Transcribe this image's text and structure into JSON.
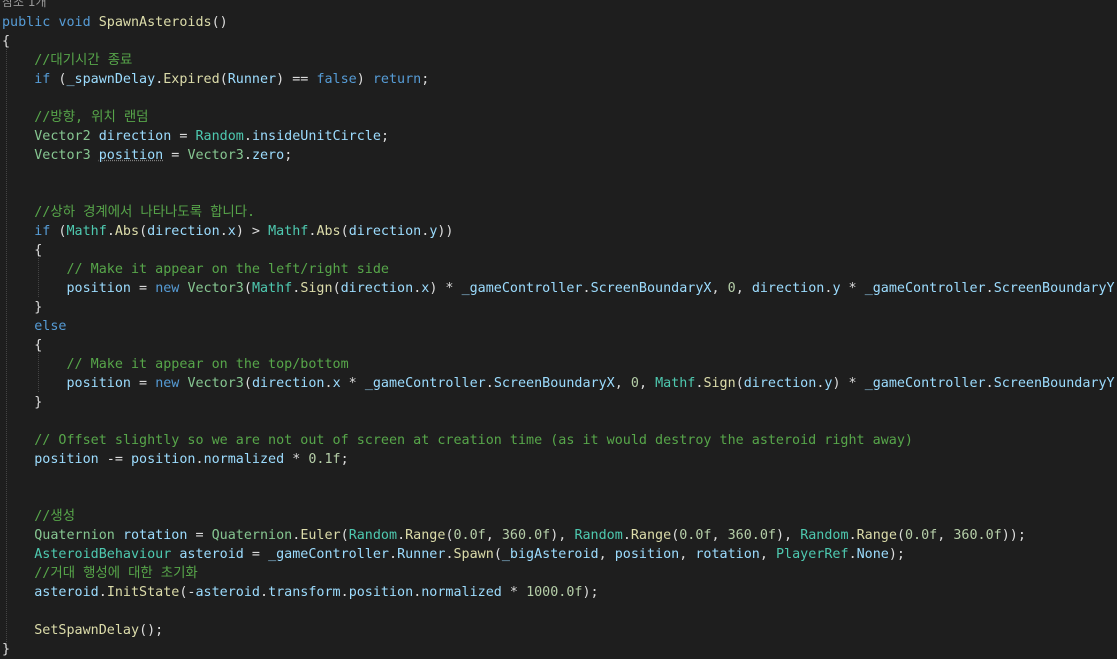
{
  "editor": {
    "codelens": "참조 1개",
    "lines": [
      [
        {
          "t": "public",
          "c": "kw"
        },
        {
          "t": " "
        },
        {
          "t": "void",
          "c": "kw"
        },
        {
          "t": " "
        },
        {
          "t": "SpawnAsteroids",
          "c": "fn"
        },
        {
          "t": "()"
        }
      ],
      [
        {
          "t": "{"
        }
      ],
      [
        {
          "t": "    //대기시간 종료",
          "c": "cm"
        }
      ],
      [
        {
          "t": "    "
        },
        {
          "t": "if",
          "c": "kw"
        },
        {
          "t": " ("
        },
        {
          "t": "_spawnDelay",
          "c": "var"
        },
        {
          "t": "."
        },
        {
          "t": "Expired",
          "c": "fn"
        },
        {
          "t": "("
        },
        {
          "t": "Runner",
          "c": "var"
        },
        {
          "t": ") == "
        },
        {
          "t": "false",
          "c": "kw"
        },
        {
          "t": ") "
        },
        {
          "t": "return",
          "c": "kw"
        },
        {
          "t": ";"
        }
      ],
      [],
      [
        {
          "t": "    //방향, 위치 랜덤",
          "c": "cm"
        }
      ],
      [
        {
          "t": "    "
        },
        {
          "t": "Vector2",
          "c": "vt"
        },
        {
          "t": " "
        },
        {
          "t": "direction",
          "c": "var"
        },
        {
          "t": " = "
        },
        {
          "t": "Random",
          "c": "ty"
        },
        {
          "t": "."
        },
        {
          "t": "insideUnitCircle",
          "c": "var"
        },
        {
          "t": ";"
        }
      ],
      [
        {
          "t": "    "
        },
        {
          "t": "Vector3",
          "c": "vt"
        },
        {
          "t": " "
        },
        {
          "t": "position",
          "c": "var",
          "u": 1
        },
        {
          "t": " = "
        },
        {
          "t": "Vector3",
          "c": "vt"
        },
        {
          "t": "."
        },
        {
          "t": "zero",
          "c": "var"
        },
        {
          "t": ";"
        }
      ],
      [],
      [],
      [
        {
          "t": "    //상하 경계에서 나타나도록 합니다.",
          "c": "cm"
        }
      ],
      [
        {
          "t": "    "
        },
        {
          "t": "if",
          "c": "kw"
        },
        {
          "t": " ("
        },
        {
          "t": "Mathf",
          "c": "ty"
        },
        {
          "t": "."
        },
        {
          "t": "Abs",
          "c": "fn"
        },
        {
          "t": "("
        },
        {
          "t": "direction",
          "c": "var"
        },
        {
          "t": "."
        },
        {
          "t": "x",
          "c": "var"
        },
        {
          "t": ") > "
        },
        {
          "t": "Mathf",
          "c": "ty"
        },
        {
          "t": "."
        },
        {
          "t": "Abs",
          "c": "fn"
        },
        {
          "t": "("
        },
        {
          "t": "direction",
          "c": "var"
        },
        {
          "t": "."
        },
        {
          "t": "y",
          "c": "var"
        },
        {
          "t": "))"
        }
      ],
      [
        {
          "t": "    {"
        }
      ],
      [
        {
          "t": "        // Make it appear on the left/right side",
          "c": "cm"
        }
      ],
      [
        {
          "t": "        "
        },
        {
          "t": "position",
          "c": "var"
        },
        {
          "t": " = "
        },
        {
          "t": "new",
          "c": "kw"
        },
        {
          "t": " "
        },
        {
          "t": "Vector3",
          "c": "vt"
        },
        {
          "t": "("
        },
        {
          "t": "Mathf",
          "c": "ty"
        },
        {
          "t": "."
        },
        {
          "t": "Sign",
          "c": "fn"
        },
        {
          "t": "("
        },
        {
          "t": "direction",
          "c": "var"
        },
        {
          "t": "."
        },
        {
          "t": "x",
          "c": "var"
        },
        {
          "t": ") * "
        },
        {
          "t": "_gameController",
          "c": "var"
        },
        {
          "t": "."
        },
        {
          "t": "ScreenBoundaryX",
          "c": "var"
        },
        {
          "t": ", "
        },
        {
          "t": "0",
          "c": "num"
        },
        {
          "t": ", "
        },
        {
          "t": "direction",
          "c": "var"
        },
        {
          "t": "."
        },
        {
          "t": "y",
          "c": "var"
        },
        {
          "t": " * "
        },
        {
          "t": "_gameController",
          "c": "var"
        },
        {
          "t": "."
        },
        {
          "t": "ScreenBoundaryY",
          "c": "var"
        },
        {
          "t": ");"
        }
      ],
      [
        {
          "t": "    }"
        }
      ],
      [
        {
          "t": "    "
        },
        {
          "t": "else",
          "c": "kw"
        }
      ],
      [
        {
          "t": "    {"
        }
      ],
      [
        {
          "t": "        // Make it appear on the top/bottom",
          "c": "cm"
        }
      ],
      [
        {
          "t": "        "
        },
        {
          "t": "position",
          "c": "var"
        },
        {
          "t": " = "
        },
        {
          "t": "new",
          "c": "kw"
        },
        {
          "t": " "
        },
        {
          "t": "Vector3",
          "c": "vt"
        },
        {
          "t": "("
        },
        {
          "t": "direction",
          "c": "var"
        },
        {
          "t": "."
        },
        {
          "t": "x",
          "c": "var"
        },
        {
          "t": " * "
        },
        {
          "t": "_gameController",
          "c": "var"
        },
        {
          "t": "."
        },
        {
          "t": "ScreenBoundaryX",
          "c": "var"
        },
        {
          "t": ", "
        },
        {
          "t": "0",
          "c": "num"
        },
        {
          "t": ", "
        },
        {
          "t": "Mathf",
          "c": "ty"
        },
        {
          "t": "."
        },
        {
          "t": "Sign",
          "c": "fn"
        },
        {
          "t": "("
        },
        {
          "t": "direction",
          "c": "var"
        },
        {
          "t": "."
        },
        {
          "t": "y",
          "c": "var"
        },
        {
          "t": ") * "
        },
        {
          "t": "_gameController",
          "c": "var"
        },
        {
          "t": "."
        },
        {
          "t": "ScreenBoundaryY",
          "c": "var"
        },
        {
          "t": ");"
        }
      ],
      [
        {
          "t": "    }"
        }
      ],
      [],
      [
        {
          "t": "    // Offset slightly so we are not out of screen at creation time (as it would destroy the asteroid right away)",
          "c": "cm"
        }
      ],
      [
        {
          "t": "    "
        },
        {
          "t": "position",
          "c": "var"
        },
        {
          "t": " -= "
        },
        {
          "t": "position",
          "c": "var"
        },
        {
          "t": "."
        },
        {
          "t": "normalized",
          "c": "var"
        },
        {
          "t": " * "
        },
        {
          "t": "0.1f",
          "c": "num"
        },
        {
          "t": ";"
        }
      ],
      [],
      [],
      [
        {
          "t": "    //생성",
          "c": "cm"
        }
      ],
      [
        {
          "t": "    "
        },
        {
          "t": "Quaternion",
          "c": "vt"
        },
        {
          "t": " "
        },
        {
          "t": "rotation",
          "c": "var"
        },
        {
          "t": " = "
        },
        {
          "t": "Quaternion",
          "c": "vt"
        },
        {
          "t": "."
        },
        {
          "t": "Euler",
          "c": "fn"
        },
        {
          "t": "("
        },
        {
          "t": "Random",
          "c": "ty"
        },
        {
          "t": "."
        },
        {
          "t": "Range",
          "c": "fn"
        },
        {
          "t": "("
        },
        {
          "t": "0.0f",
          "c": "num"
        },
        {
          "t": ", "
        },
        {
          "t": "360.0f",
          "c": "num"
        },
        {
          "t": "), "
        },
        {
          "t": "Random",
          "c": "ty"
        },
        {
          "t": "."
        },
        {
          "t": "Range",
          "c": "fn"
        },
        {
          "t": "("
        },
        {
          "t": "0.0f",
          "c": "num"
        },
        {
          "t": ", "
        },
        {
          "t": "360.0f",
          "c": "num"
        },
        {
          "t": "), "
        },
        {
          "t": "Random",
          "c": "ty"
        },
        {
          "t": "."
        },
        {
          "t": "Range",
          "c": "fn"
        },
        {
          "t": "("
        },
        {
          "t": "0.0f",
          "c": "num"
        },
        {
          "t": ", "
        },
        {
          "t": "360.0f",
          "c": "num"
        },
        {
          "t": "));"
        }
      ],
      [
        {
          "t": "    "
        },
        {
          "t": "AsteroidBehaviour",
          "c": "ty"
        },
        {
          "t": " "
        },
        {
          "t": "asteroid",
          "c": "var"
        },
        {
          "t": " = "
        },
        {
          "t": "_gameController",
          "c": "var"
        },
        {
          "t": "."
        },
        {
          "t": "Runner",
          "c": "var"
        },
        {
          "t": "."
        },
        {
          "t": "Spawn",
          "c": "fn"
        },
        {
          "t": "("
        },
        {
          "t": "_bigAsteroid",
          "c": "var"
        },
        {
          "t": ", "
        },
        {
          "t": "position",
          "c": "var"
        },
        {
          "t": ", "
        },
        {
          "t": "rotation",
          "c": "var"
        },
        {
          "t": ", "
        },
        {
          "t": "PlayerRef",
          "c": "ty"
        },
        {
          "t": "."
        },
        {
          "t": "None",
          "c": "var"
        },
        {
          "t": ");"
        }
      ],
      [
        {
          "t": "    //거대 행성에 대한 초기화",
          "c": "cm"
        }
      ],
      [
        {
          "t": "    "
        },
        {
          "t": "asteroid",
          "c": "var"
        },
        {
          "t": "."
        },
        {
          "t": "InitState",
          "c": "fn"
        },
        {
          "t": "(-"
        },
        {
          "t": "asteroid",
          "c": "var"
        },
        {
          "t": "."
        },
        {
          "t": "transform",
          "c": "var"
        },
        {
          "t": "."
        },
        {
          "t": "position",
          "c": "var"
        },
        {
          "t": "."
        },
        {
          "t": "normalized",
          "c": "var"
        },
        {
          "t": " * "
        },
        {
          "t": "1000.0f",
          "c": "num"
        },
        {
          "t": ");"
        }
      ],
      [],
      [
        {
          "t": "    "
        },
        {
          "t": "SetSpawnDelay",
          "c": "fn"
        },
        {
          "t": "();"
        }
      ],
      [
        {
          "t": "}"
        }
      ]
    ]
  }
}
